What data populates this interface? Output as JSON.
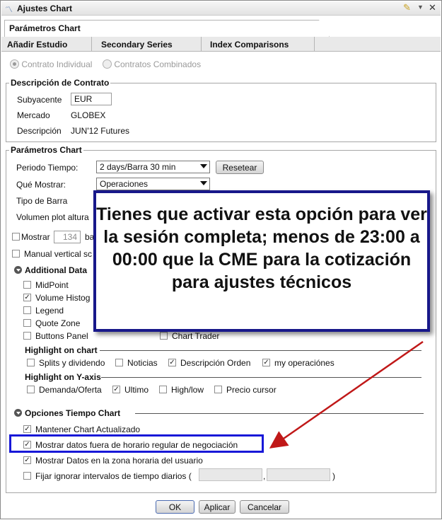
{
  "window": {
    "title": "Ajustes Chart"
  },
  "tabs": {
    "main": "Parámetros Chart",
    "sub": [
      "Añadir Estudio",
      "Secondary Series",
      "Index Comparisons"
    ]
  },
  "contract_type": {
    "option1": "Contrato Individual",
    "option2": "Contratos Combinados"
  },
  "contract": {
    "title": "Descripción de Contrato",
    "subyacente_label": "Subyacente",
    "subyacente_value": "EUR",
    "mercado_label": "Mercado",
    "mercado_value": "GLOBEX",
    "descripcion_label": "Descripción",
    "descripcion_value": "JUN'12 Futures"
  },
  "params": {
    "title": "Parámetros Chart",
    "periodo_label": "Periodo Tiempo:",
    "periodo_value": "2 days/Barra 30 min",
    "reset_label": "Resetear",
    "mostrar_label": "Qué Mostrar:",
    "mostrar_value": "Operaciones",
    "tipo_barra_label": "Tipo de Barra",
    "volumen_label": "Volumen plot altura",
    "mostrar_bars_label": "Mostrar",
    "mostrar_bars_value": "134",
    "mostrar_bars_suffix": "ba",
    "manual_label": "Manual vertical sc"
  },
  "additional": {
    "title": "Additional Data",
    "items": [
      "MidPoint",
      "Volume Histog",
      "Legend",
      "Quote Zone",
      "Buttons Panel"
    ],
    "chart_trader": "Chart Trader"
  },
  "highlight_chart": {
    "title": "Highlight on chart",
    "items": [
      "Splits y dividendo",
      "Noticias",
      "Descripción Orden",
      "my operaciónes"
    ]
  },
  "highlight_y": {
    "title": "Highlight on Y-axis",
    "items": [
      "Demanda/Oferta",
      "Ultimo",
      "High/low",
      "Precio cursor"
    ]
  },
  "time_options": {
    "title": "Opciones Tiempo Chart",
    "items": [
      "Mantener Chart Actualizado",
      "Mostrar datos fuera de horario regular de negociación",
      "Mostrar Datos en la zona horaria del usuario",
      "Fijar ignorar intervalos de tiempo diarios ("
    ],
    "sep": ",",
    "close_paren": ")"
  },
  "buttons": {
    "ok": "OK",
    "apply": "Aplicar",
    "cancel": "Cancelar"
  },
  "callout": {
    "text": "Tienes que activar esta opción para ver la sesión completa; menos de 23:00 a 00:00 que la CME para la cotización para ajustes técnicos"
  },
  "colors": {
    "callout_border": "#18188a",
    "highlight_border": "#1818d8",
    "arrow": "#c01818"
  }
}
